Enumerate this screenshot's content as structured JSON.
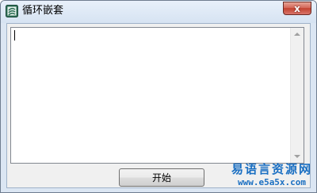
{
  "window": {
    "title": "循环嵌套",
    "close_label": "x"
  },
  "textbox": {
    "value": ""
  },
  "buttons": {
    "start_label": "开始"
  },
  "watermark": {
    "site_name": "易语言资源网",
    "url": "www.e5a5x.com"
  },
  "colors": {
    "title_bg": "#d6e3f2",
    "close_red": "#c2412f",
    "watermark_blue": "#1a6fc2"
  },
  "icons": [
    "app-icon",
    "close-icon",
    "scroll-up-arrow-icon",
    "scroll-down-arrow-icon"
  ]
}
